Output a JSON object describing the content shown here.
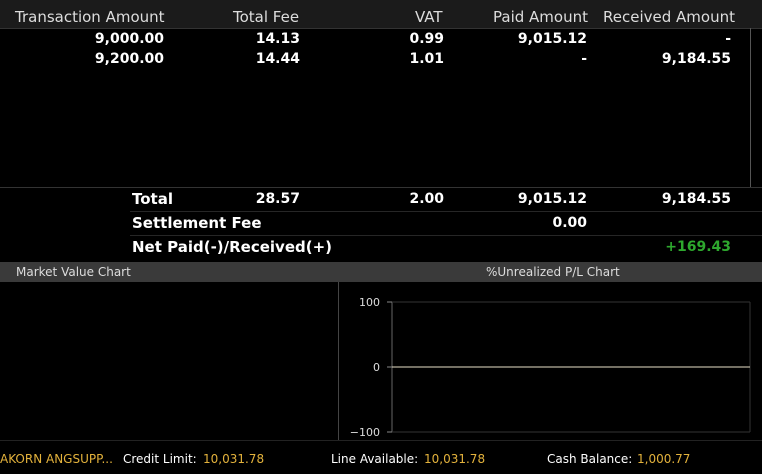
{
  "table": {
    "headers": [
      "Transaction Amount",
      "Total Fee",
      "VAT",
      "Paid Amount",
      "Received Amount"
    ],
    "rows": [
      {
        "transaction_amount": "9,000.00",
        "total_fee": "14.13",
        "vat": "0.99",
        "paid_amount": "9,015.12",
        "received_amount": "-"
      },
      {
        "transaction_amount": "9,200.00",
        "total_fee": "14.44",
        "vat": "1.01",
        "paid_amount": "-",
        "received_amount": "9,184.55"
      }
    ]
  },
  "summary": {
    "total_label": "Total",
    "total_fee": "28.57",
    "total_vat": "2.00",
    "total_paid": "9,015.12",
    "total_received": "9,184.55",
    "settlement_label": "Settlement Fee",
    "settlement_value": "0.00",
    "net_label": "Net Paid(-)/Received(+)",
    "net_value": "+169.43"
  },
  "charts": {
    "market_value_title": "Market Value Chart",
    "unrealized_title": "%Unrealized P/L Chart"
  },
  "chart_data": {
    "type": "line",
    "title": "%Unrealized P/L Chart",
    "xlabel": "",
    "ylabel": "",
    "ylim": [
      -100,
      100
    ],
    "ytick_labels": [
      "100",
      "0",
      "−100"
    ],
    "grid": false,
    "series": [
      {
        "values": [
          0,
          0
        ]
      }
    ]
  },
  "footer": {
    "account_name": "AKORN ANGSUPP...",
    "credit_limit_label": "Credit Limit:",
    "credit_limit_value": "10,031.78",
    "line_available_label": "Line Available:",
    "line_available_value": "10,031.78",
    "cash_balance_label": "Cash Balance:",
    "cash_balance_value": "1,000.77"
  },
  "colors": {
    "positive": "#2ea82e",
    "footer_value": "#e3b23c"
  }
}
